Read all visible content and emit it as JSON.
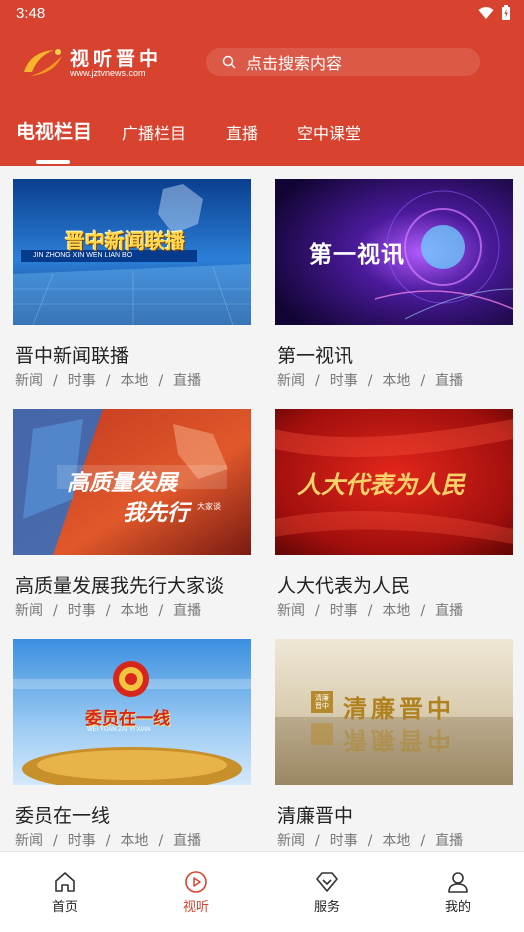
{
  "status": {
    "time": "3:48"
  },
  "header": {
    "logo_name": "视听晋中",
    "logo_url": "www.jztvnews.com",
    "search_placeholder": "点击搜索内容"
  },
  "tabs": [
    {
      "label": "电视栏目",
      "active": true
    },
    {
      "label": "广播栏目"
    },
    {
      "label": "直播"
    },
    {
      "label": "空中课堂"
    }
  ],
  "cards": [
    {
      "title": "晋中新闻联播",
      "thumb_text": "晋中新闻联播",
      "thumb_sub": "JIN ZHONG XIN WEN LIAN BO",
      "tags": [
        "新闻",
        "时事",
        "本地",
        "直播"
      ]
    },
    {
      "title": "第一视讯",
      "thumb_text": "第一视讯",
      "tags": [
        "新闻",
        "时事",
        "本地",
        "直播"
      ]
    },
    {
      "title": "高质量发展我先行大家谈",
      "thumb_text": "高质量发展",
      "thumb_text2": "我先行",
      "thumb_sub": "大家谈",
      "tags": [
        "新闻",
        "时事",
        "本地",
        "直播"
      ]
    },
    {
      "title": "人大代表为人民",
      "thumb_text": "人大代表为人民",
      "tags": [
        "新闻",
        "时事",
        "本地",
        "直播"
      ]
    },
    {
      "title": "委员在一线",
      "thumb_text": "委员在一线",
      "thumb_sub": "WEI YUAN ZAI YI XIAN",
      "tags": [
        "新闻",
        "时事",
        "本地",
        "直播"
      ]
    },
    {
      "title": "清廉晋中",
      "thumb_text": "清廉晋中",
      "thumb_badge": "清廉晋中",
      "tags": [
        "新闻",
        "时事",
        "本地",
        "直播"
      ]
    }
  ],
  "tag_separator": "/",
  "nav": [
    {
      "label": "首页",
      "icon": "home-icon"
    },
    {
      "label": "视听",
      "icon": "play-icon",
      "active": true
    },
    {
      "label": "服务",
      "icon": "service-icon"
    },
    {
      "label": "我的",
      "icon": "user-icon"
    }
  ],
  "colors": {
    "brand": "#d8432f",
    "active_nav": "#d8432f"
  }
}
